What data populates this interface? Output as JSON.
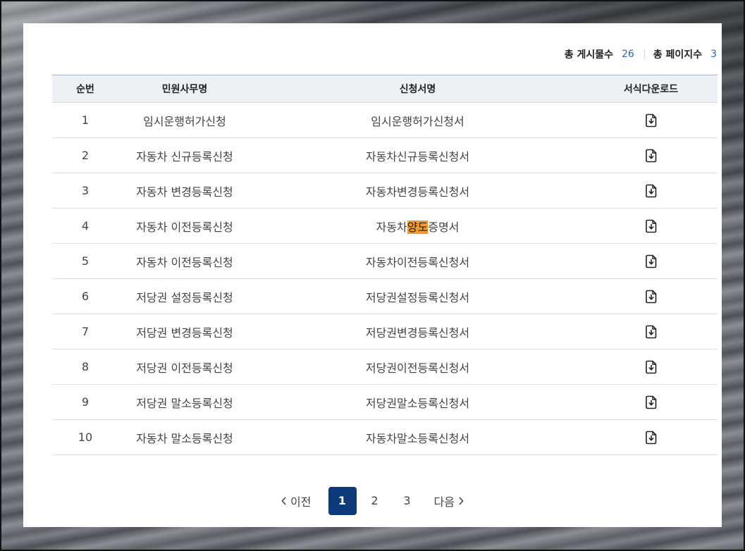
{
  "summary": {
    "posts_label": "총 게시물수",
    "posts_value": "26",
    "pages_label": "총 페이지수",
    "pages_value": "3"
  },
  "table": {
    "headers": [
      "순번",
      "민원사무명",
      "신청서명",
      "서식다운로드"
    ],
    "rows": [
      {
        "no": "1",
        "service": "임시운행허가신청",
        "form": "임시운행허가신청서"
      },
      {
        "no": "2",
        "service": "자동차 신규등록신청",
        "form": "자동차신규등록신청서"
      },
      {
        "no": "3",
        "service": "자동차 변경등록신청",
        "form": "자동차변경등록신청서"
      },
      {
        "no": "4",
        "service": "자동차 이전등록신청",
        "form_pre": "자동차",
        "form_hl": "양도",
        "form_post": "증명서"
      },
      {
        "no": "5",
        "service": "자동차 이전등록신청",
        "form": "자동차이전등록신청서"
      },
      {
        "no": "6",
        "service": "저당권 설정등록신청",
        "form": "저당권설정등록신청서"
      },
      {
        "no": "7",
        "service": "저당권 변경등록신청",
        "form": "저당권변경등록신청서"
      },
      {
        "no": "8",
        "service": "저당권 이전등록신청",
        "form": "저당권이전등록신청서"
      },
      {
        "no": "9",
        "service": "저당권 말소등록신청",
        "form": "저당권말소등록신청서"
      },
      {
        "no": "10",
        "service": "자동차 말소등록신청",
        "form": "자동차말소등록신청서"
      }
    ],
    "download_icon": "file-download-icon"
  },
  "pagination": {
    "prev_label": "이전",
    "next_label": "다음",
    "pages": [
      "1",
      "2",
      "3"
    ],
    "current": "1"
  },
  "colors": {
    "accent": "#0d3a78",
    "count": "#2d66b5",
    "highlight": "#f39a2f",
    "header_bg": "#edf1f5"
  }
}
